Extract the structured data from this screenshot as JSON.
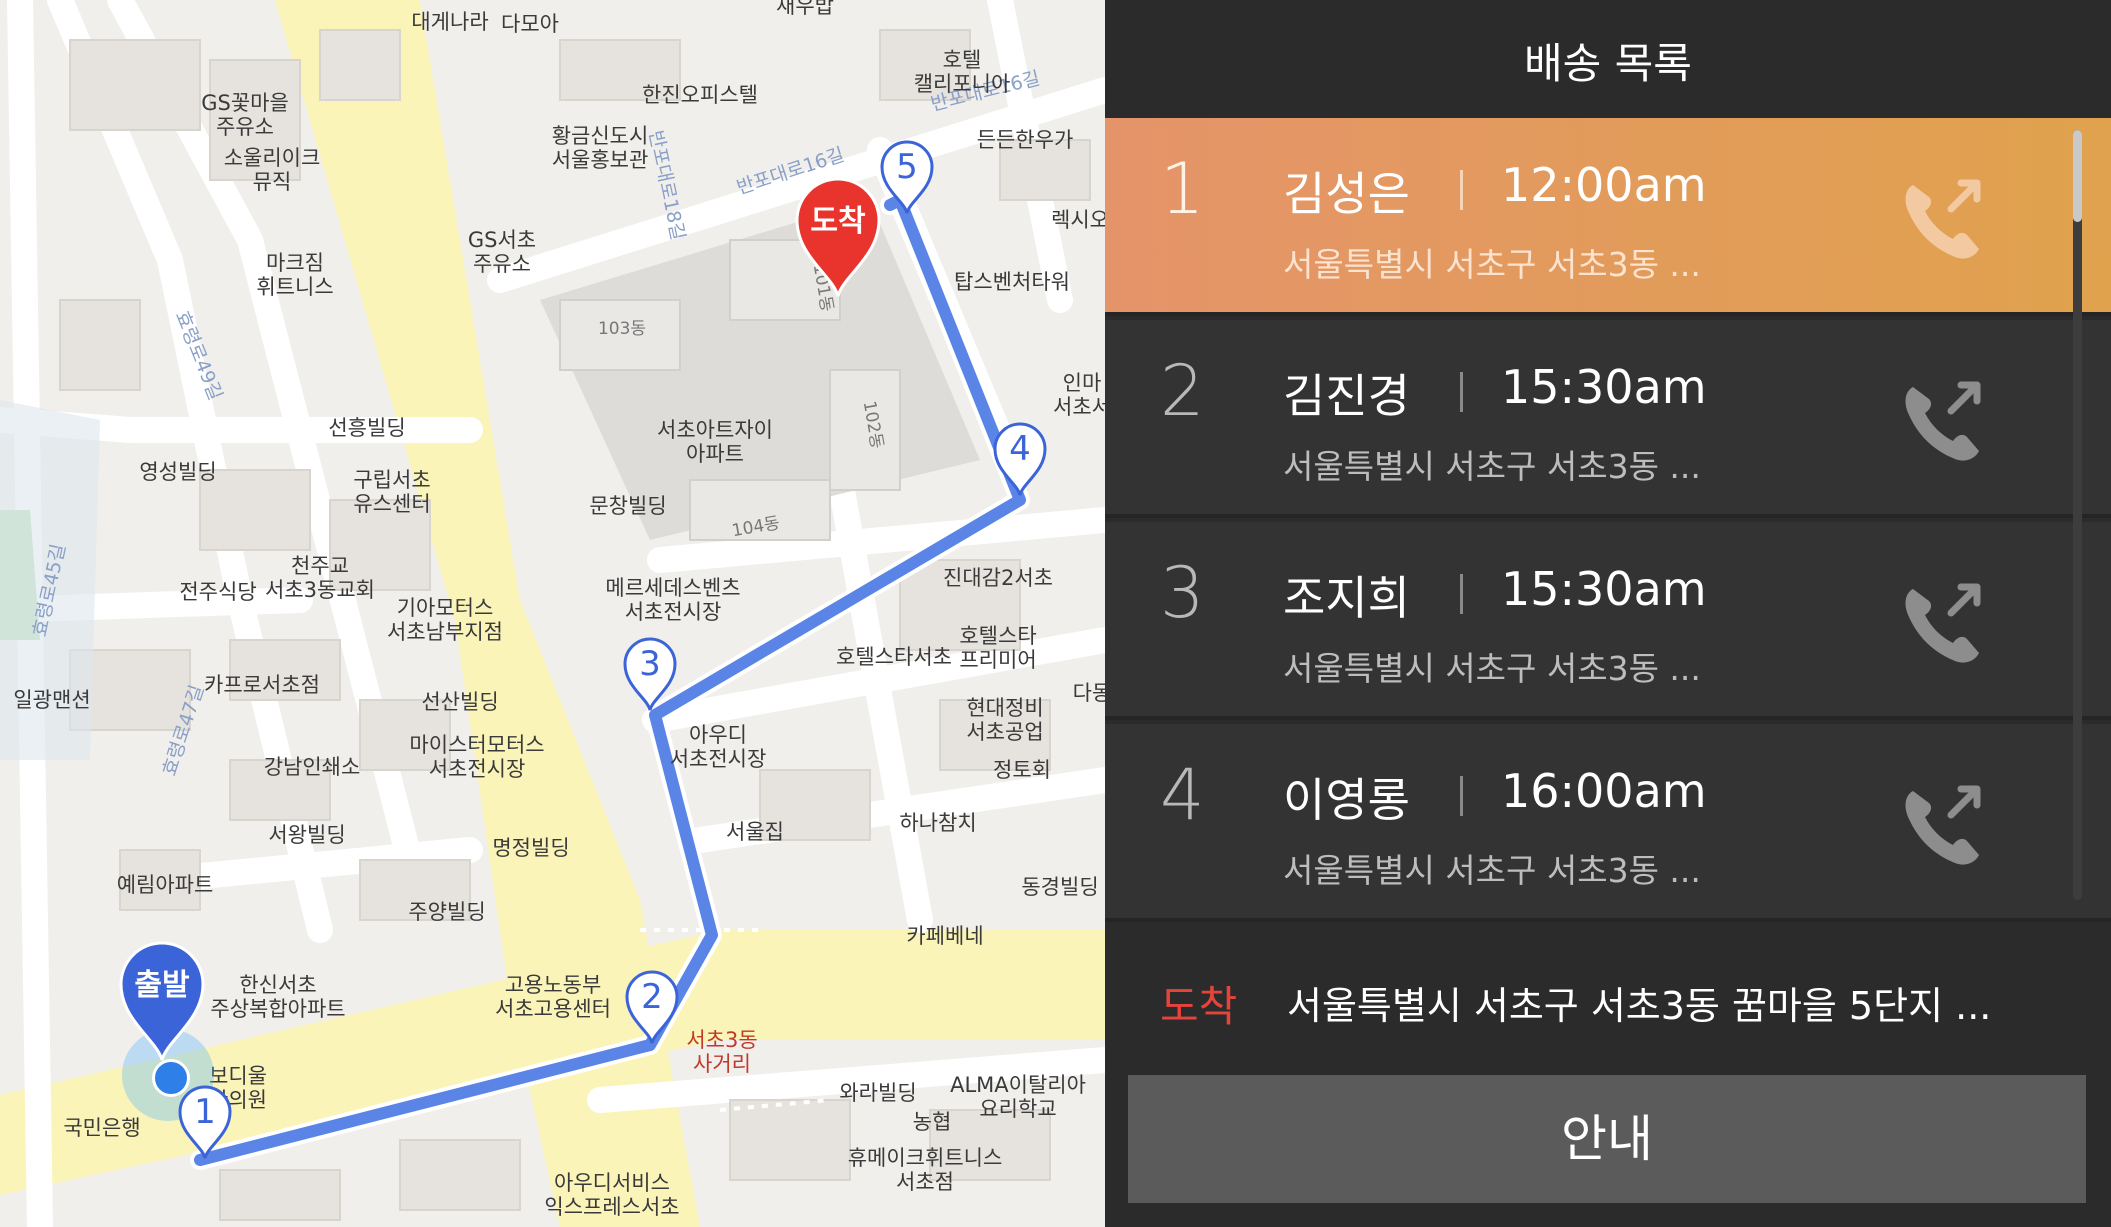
{
  "panel": {
    "title": "배송 목록",
    "deliveries": [
      {
        "num": "1",
        "name": "김성은",
        "time": "12:00am",
        "address": "서울특별시 서초구 서초3동 ...",
        "active": true,
        "call_icon": "phone-call-icon"
      },
      {
        "num": "2",
        "name": "김진경",
        "time": "15:30am",
        "address": "서울특별시 서초구 서초3동 ...",
        "active": false,
        "call_icon": "phone-call-icon"
      },
      {
        "num": "3",
        "name": "조지희",
        "time": "15:30am",
        "address": "서울특별시 서초구 서초3동 ...",
        "active": false,
        "call_icon": "phone-call-icon"
      },
      {
        "num": "4",
        "name": "이영롱",
        "time": "16:00am",
        "address": "서울특별시 서초구 서초3동 ...",
        "active": false,
        "call_icon": "phone-call-icon"
      }
    ],
    "destination": {
      "tag": "도착",
      "address": "서울특별시 서초구 서초3동 꿈마을 5단지 ..."
    },
    "guide_button": "안내",
    "colors": {
      "active_row": "#e39a5c",
      "dest_tag": "#e8433b",
      "route": "#5a84e6",
      "arrival_pin": "#e8342c",
      "departure_pin": "#3a64d8"
    }
  },
  "map": {
    "start_pin": "출발",
    "end_pin": "도착",
    "waypoints": [
      "1",
      "2",
      "3",
      "4",
      "5"
    ],
    "labels": {
      "l01": "대게나라",
      "l02": "다모아",
      "l03": "호텔\n캘리포니아",
      "l04": "한진오피스텔",
      "l05": "GS꽃마을\n주유소",
      "l06": "소울리이크\n뮤직",
      "l07": "황금신도시\n서울홍보관",
      "l08": "든든한우가",
      "l09": "GS서초\n주유소",
      "l10": "마크짐\n휘트니스",
      "l11": "렉시오",
      "l12": "탑스벤처타워",
      "l13": "103동",
      "l14": "101동",
      "l15": "서초아트자이\n아파트",
      "l16": "102동",
      "l17": "선흥빌딩",
      "l18": "영성빌딩",
      "l19": "구립서초\n유스센터",
      "l20": "문창빌딩",
      "l21": "104동",
      "l22": "천주교\n서초3동교회",
      "l23": "전주식당",
      "l24": "기아모터스\n서초남부지점",
      "l25": "메르세데스벤츠\n서초전시장",
      "l26": "진대감2서초",
      "l27": "호텔스타서초",
      "l28": "호텔스타\n프리미어",
      "l29": "일광맨션",
      "l30": "카프로서초점",
      "l31": "선산빌딩",
      "l32": "현대정비\n서초공업",
      "l33": "마이스터모터스\n서초전시장",
      "l34": "아우디\n서초전시장",
      "l35": "강남인쇄소",
      "l36": "정토회",
      "l37": "서왕빌딩",
      "l38": "명정빌딩",
      "l39": "서울집",
      "l40": "하나참치",
      "l41": "예림아파트",
      "l42": "주양빌딩",
      "l43": "동경빌딩",
      "l44": "카페베네",
      "l45": "한신서초\n주상복합아파트",
      "l46": "고용노동부\n서초고용센터",
      "l47": "서초3동\n사거리",
      "l48": "보디울\n한의원",
      "l49": "와라빌딩",
      "l50": "ALMA이탈리아\n요리학교",
      "l51": "농협",
      "l52": "국민은행",
      "l53": "휴메이크휘트니스\n서초점",
      "l54": "아우디서비스\n익스프레스서초",
      "l55": "인마\n서초서",
      "l56": "새우밥",
      "l57": "다동"
    },
    "roads": {
      "r1": "반포대로16길",
      "r2": "반포대로16길",
      "r3": "반포대로18길",
      "r4": "효령로49길",
      "r5": "효령로47길",
      "r6": "효령로45길"
    }
  }
}
